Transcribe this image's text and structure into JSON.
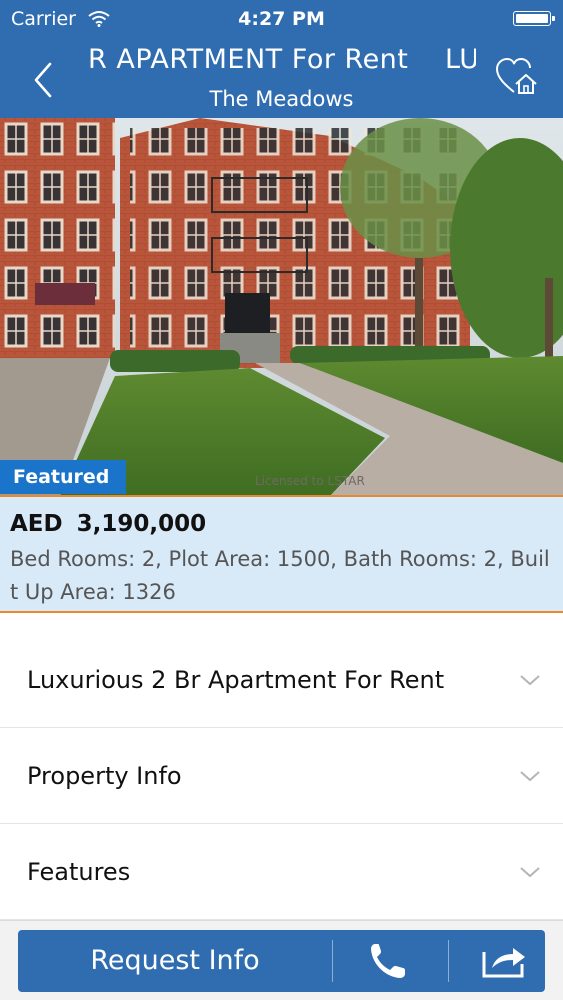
{
  "status_bar": {
    "carrier": "Carrier",
    "time": "4:27 PM"
  },
  "nav": {
    "title_marquee": "R APARTMENT For Rent",
    "title_marquee_next": "LU",
    "subtitle": "The Meadows"
  },
  "listing": {
    "badge": "Featured",
    "photo_watermark": "Licensed to LSTAR",
    "currency": "AED",
    "price": "3,190,000",
    "specs": "Bed Rooms:  2, Plot Area:  1500, Bath Rooms:  2, Built Up Area:  1326"
  },
  "sections": [
    {
      "label": "Luxurious 2 Br Apartment For Rent"
    },
    {
      "label": "Property Info"
    },
    {
      "label": "Features"
    }
  ],
  "actions": {
    "request_label": "Request Info"
  },
  "colors": {
    "primary": "#2f6db0",
    "badge": "#1a74c9",
    "price_panel": "#d8e9f8",
    "accent_border": "#e7892e"
  },
  "icons": [
    "back-chevron-icon",
    "favorite-home-icon",
    "chevron-down-icon",
    "phone-icon",
    "share-icon",
    "wifi-icon",
    "battery-icon"
  ]
}
